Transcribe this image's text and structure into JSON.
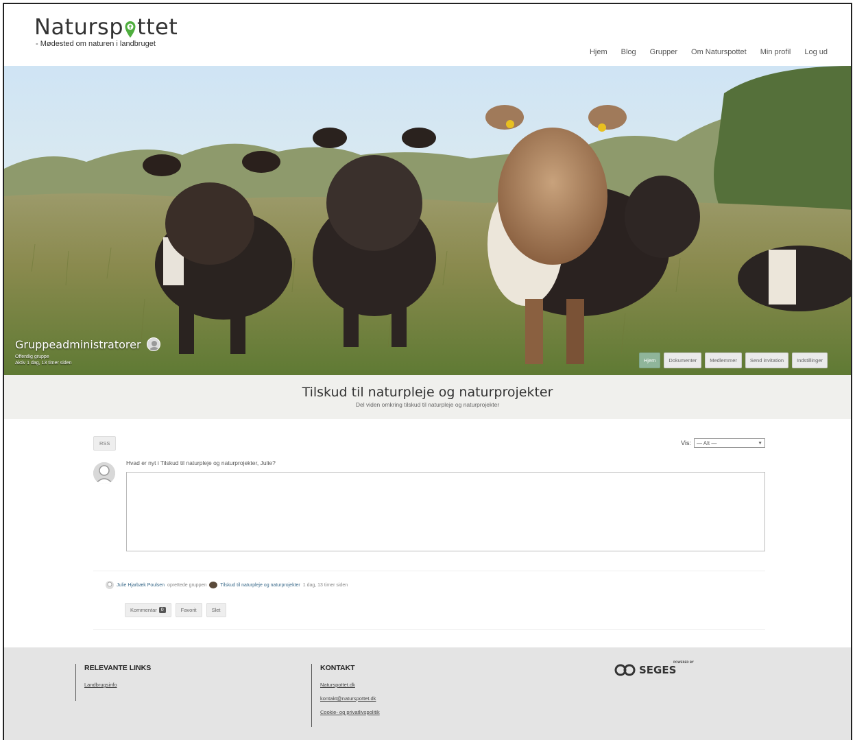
{
  "brand": {
    "name_part1": "Natursp",
    "name_part2": "ttet",
    "tagline": "- Mødested om naturen i landbruget"
  },
  "nav": {
    "items": [
      "Hjem",
      "Blog",
      "Grupper",
      "Om Naturspottet",
      "Min profil",
      "Log ud"
    ]
  },
  "hero": {
    "admin_label": "Gruppeadministratorer",
    "group_type": "Offentlig gruppe",
    "active_since": "Aktiv 1 dag, 13 timer siden",
    "tabs": [
      "Hjem",
      "Dokumenter",
      "Medlemmer",
      "Send invitation",
      "Indstillinger"
    ]
  },
  "group": {
    "title": "Tilskud til naturpleje og naturprojekter",
    "description": "Del viden omkring tilskud til naturpleje og naturprojekter"
  },
  "feed": {
    "rss_label": "RSS",
    "vis_label": "Vis:",
    "vis_selected": "— Alt —",
    "prompt": "Hvad er nyt i Tilskud til naturpleje og naturprojekter, Julie?",
    "activity": {
      "user": "Julie Hjarbæk Poulsen",
      "action": "oprettede gruppen",
      "group": "Tilskud til naturpleje og naturprojekter",
      "time": "1 dag, 13 timer siden",
      "comment_label": "Kommentar",
      "comment_count": "0",
      "favorite_label": "Favorit",
      "delete_label": "Slet"
    }
  },
  "footer": {
    "links_heading": "RELEVANTE LINKS",
    "links": [
      "Landbrugsinfo"
    ],
    "contact_heading": "KONTAKT",
    "contact": [
      "Naturspottet.dk",
      "kontakt@naturspottet.dk",
      "Cookie- og privatlivspolitik"
    ],
    "powered_by": "POWERED BY",
    "seges": "SEGES"
  },
  "colors": {
    "accent_green": "#8fb59a",
    "footer_bg": "#e4e4e4",
    "band_bg": "#f0f0ed"
  }
}
